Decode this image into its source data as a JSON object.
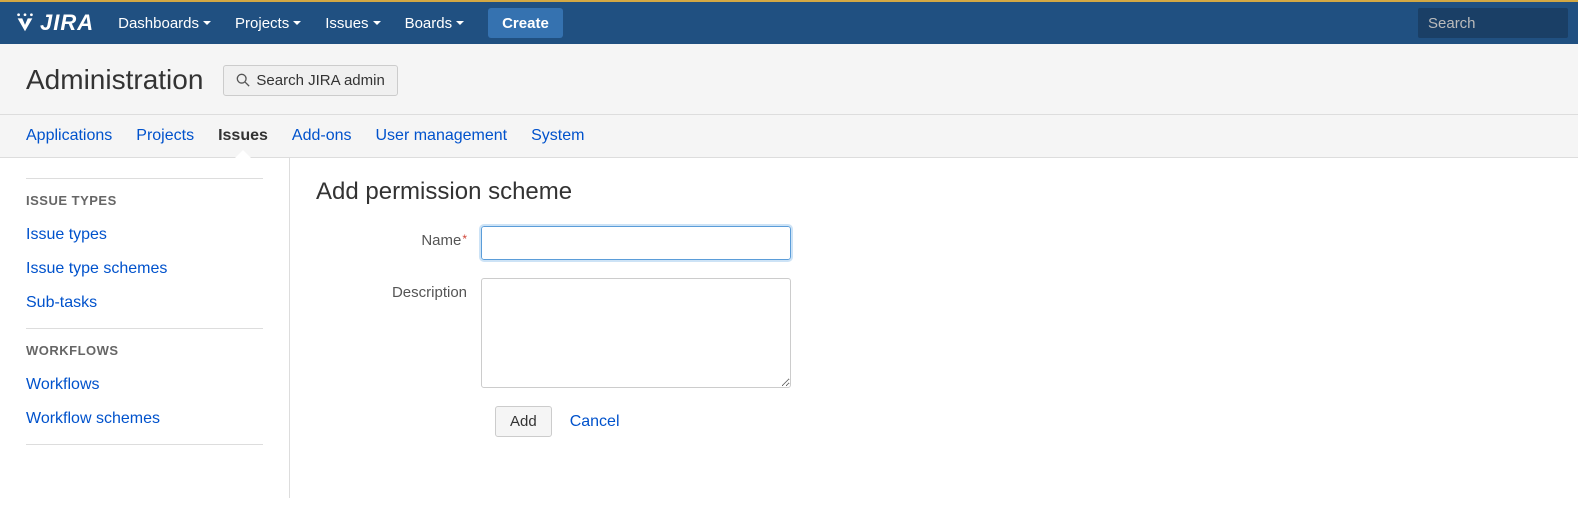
{
  "topnav": {
    "logo_text": "JIRA",
    "items": [
      "Dashboards",
      "Projects",
      "Issues",
      "Boards"
    ],
    "create_label": "Create",
    "search_placeholder": "Search"
  },
  "admin_header": {
    "title": "Administration",
    "search_admin_label": "Search JIRA admin"
  },
  "admin_tabs": {
    "items": [
      "Applications",
      "Projects",
      "Issues",
      "Add-ons",
      "User management",
      "System"
    ],
    "active_index": 2
  },
  "sidebar": {
    "groups": [
      {
        "header": "ISSUE TYPES",
        "links": [
          "Issue types",
          "Issue type schemes",
          "Sub-tasks"
        ]
      },
      {
        "header": "WORKFLOWS",
        "links": [
          "Workflows",
          "Workflow schemes"
        ]
      }
    ]
  },
  "main": {
    "heading": "Add permission scheme",
    "name_label": "Name",
    "name_value": "",
    "description_label": "Description",
    "description_value": "",
    "add_label": "Add",
    "cancel_label": "Cancel"
  }
}
